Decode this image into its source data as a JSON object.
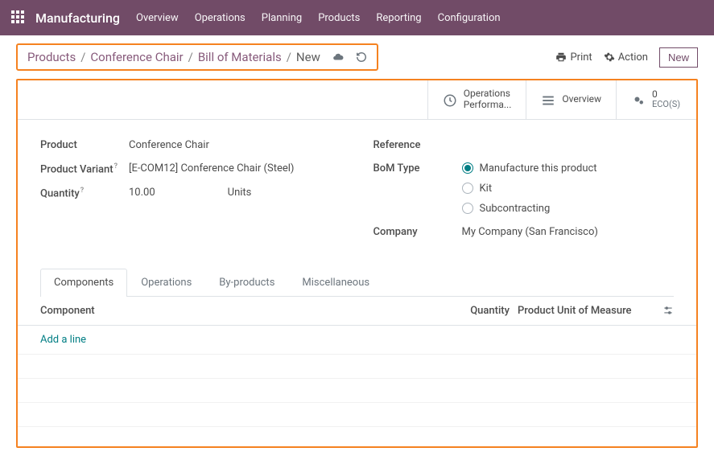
{
  "topbar": {
    "app_title": "Manufacturing",
    "menu": [
      "Overview",
      "Operations",
      "Planning",
      "Products",
      "Reporting",
      "Configuration"
    ]
  },
  "breadcrumb": {
    "items": [
      "Products",
      "Conference Chair",
      "Bill of Materials"
    ],
    "current": "New"
  },
  "controls": {
    "print": "Print",
    "action": "Action",
    "new": "New"
  },
  "stat_buttons": {
    "ops": {
      "line1": "Operations",
      "line2": "Performa..."
    },
    "overview": "Overview",
    "eco": {
      "count": "0",
      "label": "ECO(S)"
    }
  },
  "form": {
    "product_label": "Product",
    "product_value": "Conference Chair",
    "variant_label": "Product Variant",
    "variant_value": "[E-COM12] Conference Chair (Steel)",
    "quantity_label": "Quantity",
    "quantity_value": "10.00",
    "quantity_unit": "Units",
    "reference_label": "Reference",
    "bom_type_label": "BoM Type",
    "bom_options": {
      "manufacture": "Manufacture this product",
      "kit": "Kit",
      "subcontracting": "Subcontracting"
    },
    "company_label": "Company",
    "company_value": "My Company (San Francisco)"
  },
  "tabs": [
    "Components",
    "Operations",
    "By-products",
    "Miscellaneous"
  ],
  "grid": {
    "col_component": "Component",
    "col_quantity": "Quantity",
    "col_uom": "Product Unit of Measure",
    "add_line": "Add a line"
  }
}
